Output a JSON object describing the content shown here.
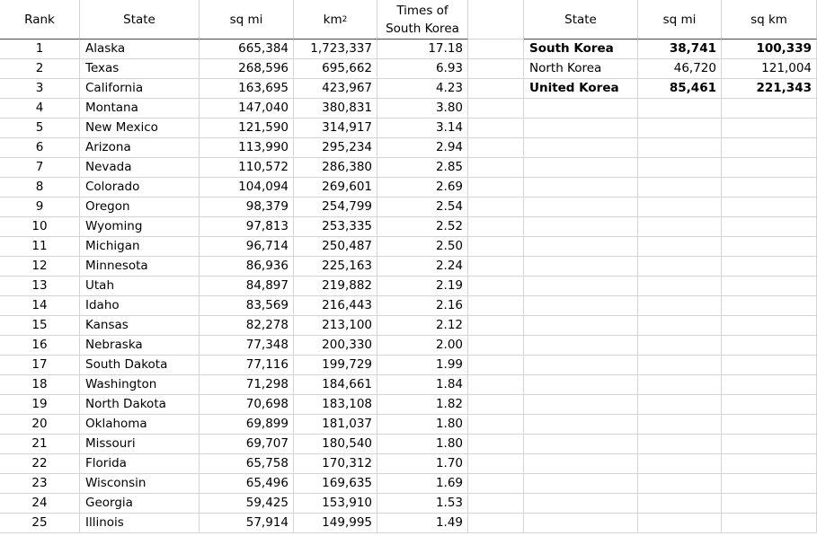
{
  "us_table": {
    "headers": {
      "rank": "Rank",
      "state": "State",
      "sq_mi": "sq mi",
      "km2_base": "km",
      "km2_sup": "2",
      "times_line1": "Times of",
      "times_line2": "South Korea"
    },
    "rows": [
      {
        "rank": "1",
        "state": "Alaska",
        "sq_mi": "665,384",
        "km2": "1,723,337",
        "times": "17.18"
      },
      {
        "rank": "2",
        "state": "Texas",
        "sq_mi": "268,596",
        "km2": "695,662",
        "times": "6.93"
      },
      {
        "rank": "3",
        "state": "California",
        "sq_mi": "163,695",
        "km2": "423,967",
        "times": "4.23"
      },
      {
        "rank": "4",
        "state": "Montana",
        "sq_mi": "147,040",
        "km2": "380,831",
        "times": "3.80"
      },
      {
        "rank": "5",
        "state": "New Mexico",
        "sq_mi": "121,590",
        "km2": "314,917",
        "times": "3.14"
      },
      {
        "rank": "6",
        "state": "Arizona",
        "sq_mi": "113,990",
        "km2": "295,234",
        "times": "2.94"
      },
      {
        "rank": "7",
        "state": "Nevada",
        "sq_mi": "110,572",
        "km2": "286,380",
        "times": "2.85"
      },
      {
        "rank": "8",
        "state": "Colorado",
        "sq_mi": "104,094",
        "km2": "269,601",
        "times": "2.69"
      },
      {
        "rank": "9",
        "state": "Oregon",
        "sq_mi": "98,379",
        "km2": "254,799",
        "times": "2.54"
      },
      {
        "rank": "10",
        "state": "Wyoming",
        "sq_mi": "97,813",
        "km2": "253,335",
        "times": "2.52"
      },
      {
        "rank": "11",
        "state": "Michigan",
        "sq_mi": "96,714",
        "km2": "250,487",
        "times": "2.50"
      },
      {
        "rank": "12",
        "state": "Minnesota",
        "sq_mi": "86,936",
        "km2": "225,163",
        "times": "2.24"
      },
      {
        "rank": "13",
        "state": "Utah",
        "sq_mi": "84,897",
        "km2": "219,882",
        "times": "2.19"
      },
      {
        "rank": "14",
        "state": "Idaho",
        "sq_mi": "83,569",
        "km2": "216,443",
        "times": "2.16"
      },
      {
        "rank": "15",
        "state": "Kansas",
        "sq_mi": "82,278",
        "km2": "213,100",
        "times": "2.12"
      },
      {
        "rank": "16",
        "state": "Nebraska",
        "sq_mi": "77,348",
        "km2": "200,330",
        "times": "2.00"
      },
      {
        "rank": "17",
        "state": "South Dakota",
        "sq_mi": "77,116",
        "km2": "199,729",
        "times": "1.99"
      },
      {
        "rank": "18",
        "state": "Washington",
        "sq_mi": "71,298",
        "km2": "184,661",
        "times": "1.84"
      },
      {
        "rank": "19",
        "state": "North Dakota",
        "sq_mi": "70,698",
        "km2": "183,108",
        "times": "1.82"
      },
      {
        "rank": "20",
        "state": "Oklahoma",
        "sq_mi": "69,899",
        "km2": "181,037",
        "times": "1.80"
      },
      {
        "rank": "21",
        "state": "Missouri",
        "sq_mi": "69,707",
        "km2": "180,540",
        "times": "1.80"
      },
      {
        "rank": "22",
        "state": "Florida",
        "sq_mi": "65,758",
        "km2": "170,312",
        "times": "1.70"
      },
      {
        "rank": "23",
        "state": "Wisconsin",
        "sq_mi": "65,496",
        "km2": "169,635",
        "times": "1.69"
      },
      {
        "rank": "24",
        "state": "Georgia",
        "sq_mi": "59,425",
        "km2": "153,910",
        "times": "1.53"
      },
      {
        "rank": "25",
        "state": "Illinois",
        "sq_mi": "57,914",
        "km2": "149,995",
        "times": "1.49"
      }
    ]
  },
  "korea_table": {
    "headers": {
      "state": "State",
      "sq_mi": "sq mi",
      "sq_km": "sq km"
    },
    "rows": [
      {
        "state": "South Korea",
        "sq_mi": "38,741",
        "sq_km": "100,339",
        "bold": true
      },
      {
        "state": "North Korea",
        "sq_mi": "46,720",
        "sq_km": "121,004",
        "bold": false
      },
      {
        "state": "United Korea",
        "sq_mi": "85,461",
        "sq_km": "221,343",
        "bold": true
      }
    ]
  }
}
